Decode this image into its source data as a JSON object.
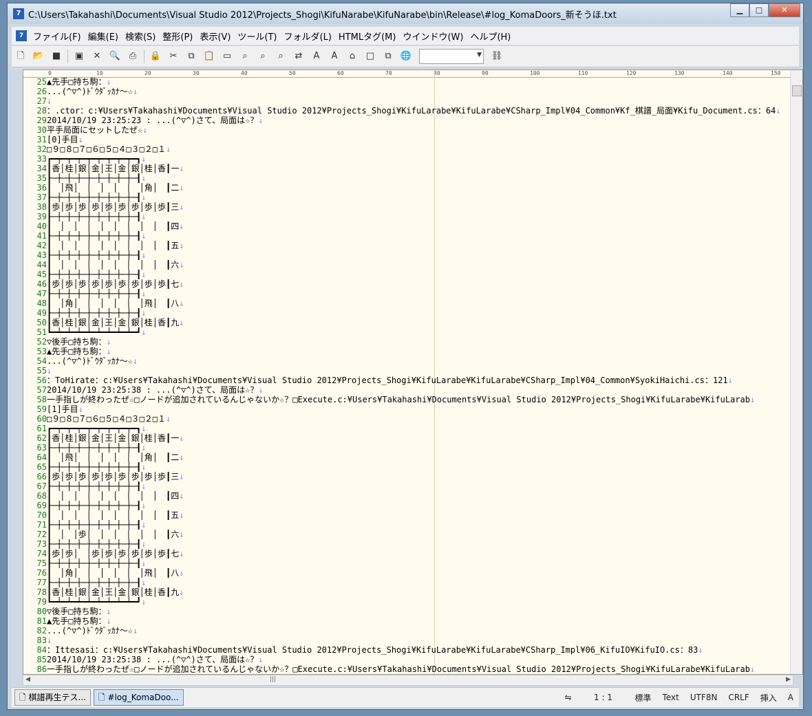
{
  "window": {
    "title": "C:\\Users\\Takahashi\\Documents\\Visual Studio 2012\\Projects_Shogi\\KifuNarabe\\KifuNarabe\\bin\\Release\\#log_KomaDoors_新そうほ.txt"
  },
  "menus": [
    "ファイル(F)",
    "編集(E)",
    "検索(S)",
    "整形(P)",
    "表示(V)",
    "ツール(T)",
    "フォルダ(L)",
    "HTMLタグ(M)",
    "ウインドウ(W)",
    "ヘルプ(H)"
  ],
  "ruler": [
    "0",
    "10",
    "20",
    "30",
    "40",
    "50",
    "60",
    "70",
    "80",
    "90",
    "100",
    "110",
    "120",
    "130",
    "140",
    "150"
  ],
  "lines": [
    {
      "n": "25",
      "t": "▲先手□持ち駒："
    },
    {
      "n": "26",
      "t": "...(^▽^)ﾄﾞｳﾀﾞｯｶﾅ～☆"
    },
    {
      "n": "27",
      "t": ""
    },
    {
      "n": "28",
      "t": "：.ctor：c:¥Users¥Takahashi¥Documents¥Visual Studio 2012¥Projects_Shogi¥KifuLarabe¥KifuLarabe¥CSharp_Impl¥04_Common¥Kf_棋譜_局面¥Kifu_Document.cs：64"
    },
    {
      "n": "29",
      "t": "2014/10/19 23:25:23 : ...(^▽^)さて、局面は☆？"
    },
    {
      "n": "30",
      "t": "平手局面にセットしたぜ☆"
    },
    {
      "n": "31",
      "t": "[0]手目"
    },
    {
      "n": "32",
      "t": "□９□８□７□６□５□４□３□２□１"
    },
    {
      "n": "33",
      "t": "┏━┯━┯━┯━┯━┯━┯━┯━┯━┓"
    },
    {
      "n": "34",
      "t": "┃香│桂│銀│金│王│金│銀│桂│香┃一"
    },
    {
      "n": "35",
      "t": "┠─┼─┼─┼─┼─┼─┼─┼─┼─┨"
    },
    {
      "n": "36",
      "t": "┃　│飛│　│　│　│　│　│角│　┃二"
    },
    {
      "n": "37",
      "t": "┠─┼─┼─┼─┼─┼─┼─┼─┼─┨"
    },
    {
      "n": "38",
      "t": "┃歩│歩│歩│歩│歩│歩│歩│歩│歩┃三"
    },
    {
      "n": "39",
      "t": "┠─┼─┼─┼─┼─┼─┼─┼─┼─┨"
    },
    {
      "n": "40",
      "t": "┃　│　│　│　│　│　│　│　│　┃四"
    },
    {
      "n": "41",
      "t": "┠─┼─┼─┼─┼─┼─┼─┼─┼─┨"
    },
    {
      "n": "42",
      "t": "┃　│　│　│　│　│　│　│　│　┃五"
    },
    {
      "n": "43",
      "t": "┠─┼─┼─┼─┼─┼─┼─┼─┼─┨"
    },
    {
      "n": "44",
      "t": "┃　│　│　│　│　│　│　│　│　┃六"
    },
    {
      "n": "45",
      "t": "┠─┼─┼─┼─┼─┼─┼─┼─┼─┨"
    },
    {
      "n": "46",
      "t": "┃歩│歩│歩│歩│歩│歩│歩│歩│歩┃七"
    },
    {
      "n": "47",
      "t": "┠─┼─┼─┼─┼─┼─┼─┼─┼─┨"
    },
    {
      "n": "48",
      "t": "┃　│角│　│　│　│　│　│飛│　┃八"
    },
    {
      "n": "49",
      "t": "┠─┼─┼─┼─┼─┼─┼─┼─┼─┨"
    },
    {
      "n": "50",
      "t": "┃香│桂│銀│金│王│金│銀│桂│香┃九"
    },
    {
      "n": "51",
      "t": "┗━┷━┷━┷━┷━┷━┷━┷━┷━┛"
    },
    {
      "n": "52",
      "t": "▽後手□持ち駒："
    },
    {
      "n": "53",
      "t": "▲先手□持ち駒："
    },
    {
      "n": "54",
      "t": "...(^▽^)ﾄﾞｳﾀﾞｯｶﾅ～☆"
    },
    {
      "n": "55",
      "t": ""
    },
    {
      "n": "56",
      "t": "：ToHirate：c:¥Users¥Takahashi¥Documents¥Visual Studio 2012¥Projects_Shogi¥KifuLarabe¥KifuLarabe¥CSharp_Impl¥04_Common¥SyokiHaichi.cs：121"
    },
    {
      "n": "57",
      "t": "2014/10/19 23:25:38 : ...(^▽^)さて、局面は☆？"
    },
    {
      "n": "58",
      "t": "一手指しが終わったぜ☆□ノードが追加されているんじゃないか☆？□Execute.c:¥Users¥Takahashi¥Documents¥Visual Studio 2012¥Projects_Shogi¥KifuLarabe¥KifuLarab"
    },
    {
      "n": "59",
      "t": "[1]手目"
    },
    {
      "n": "60",
      "t": "□９□８□７□６□５□４□３□２□１"
    },
    {
      "n": "61",
      "t": "┏━┯━┯━┯━┯━┯━┯━┯━┯━┓"
    },
    {
      "n": "62",
      "t": "┃香│桂│銀│金│王│金│銀│桂│香┃一"
    },
    {
      "n": "63",
      "t": "┠─┼─┼─┼─┼─┼─┼─┼─┼─┨"
    },
    {
      "n": "64",
      "t": "┃　│飛│　│　│　│　│　│角│　┃二"
    },
    {
      "n": "65",
      "t": "┠─┼─┼─┼─┼─┼─┼─┼─┼─┨"
    },
    {
      "n": "66",
      "t": "┃歩│歩│歩│歩│歩│歩│歩│歩│歩┃三"
    },
    {
      "n": "67",
      "t": "┠─┼─┼─┼─┼─┼─┼─┼─┼─┨"
    },
    {
      "n": "68",
      "t": "┃　│　│　│　│　│　│　│　│　┃四"
    },
    {
      "n": "69",
      "t": "┠─┼─┼─┼─┼─┼─┼─┼─┼─┨"
    },
    {
      "n": "70",
      "t": "┃　│　│　│　│　│　│　│　│　┃五"
    },
    {
      "n": "71",
      "t": "┠─┼─┼─┼─┼─┼─┼─┼─┼─┨"
    },
    {
      "n": "72",
      "t": "┃　│　│歩│　│　│　│　│　│　┃六"
    },
    {
      "n": "73",
      "t": "┠─┼─┼─┼─┼─┼─┼─┼─┼─┨"
    },
    {
      "n": "74",
      "t": "┃歩│歩│　│歩│歩│歩│歩│歩│歩┃七"
    },
    {
      "n": "75",
      "t": "┠─┼─┼─┼─┼─┼─┼─┼─┼─┨"
    },
    {
      "n": "76",
      "t": "┃　│角│　│　│　│　│　│飛│　┃八"
    },
    {
      "n": "77",
      "t": "┠─┼─┼─┼─┼─┼─┼─┼─┼─┨"
    },
    {
      "n": "78",
      "t": "┃香│桂│銀│金│王│金│銀│桂│香┃九"
    },
    {
      "n": "79",
      "t": "┗━┷━┷━┷━┷━┷━┷━┷━┷━┛"
    },
    {
      "n": "80",
      "t": "▽後手□持ち駒："
    },
    {
      "n": "81",
      "t": "▲先手□持ち駒："
    },
    {
      "n": "82",
      "t": "...(^▽^)ﾄﾞｳﾀﾞｯｶﾅ～☆"
    },
    {
      "n": "83",
      "t": ""
    },
    {
      "n": "84",
      "t": "：Ittesasi：c:¥Users¥Takahashi¥Documents¥Visual Studio 2012¥Projects_Shogi¥KifuLarabe¥KifuLarabe¥CSharp_Impl¥06_KifuIO¥KifuIO.cs：83"
    },
    {
      "n": "85",
      "t": "2014/10/19 23:25:38 : ...(^▽^)さて、局面は☆？"
    },
    {
      "n": "86",
      "t": "一手指しが終わったぜ☆□ノードが追加されているんじゃないか☆？□Execute.c:¥Users¥Takahashi¥Documents¥Visual Studio 2012¥Projects_Shogi¥KifuLarabe¥KifuLarab"
    }
  ],
  "tabs": [
    "棋譜再生テス...",
    "#log_KomaDoo..."
  ],
  "status": {
    "position": "1 : 1",
    "mode": "標準",
    "type": "Text",
    "encoding": "UTF8N",
    "eol": "CRLF",
    "insert": "挿入",
    "ime": "A"
  }
}
